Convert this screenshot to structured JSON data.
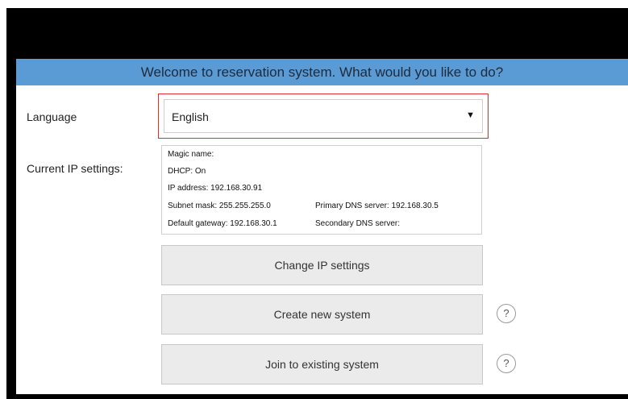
{
  "header": {
    "title": "Welcome to reservation system. What would you like to do?"
  },
  "language": {
    "label": "Language",
    "selected": "English",
    "arrow": "▼"
  },
  "ip": {
    "label": "Current IP settings:",
    "magic_name": "Magic name:",
    "dhcp": "DHCP: On",
    "ip_address": "IP address: 192.168.30.91",
    "subnet_mask": "Subnet mask: 255.255.255.0",
    "primary_dns": "Primary DNS server: 192.168.30.5",
    "default_gateway": "Default gateway: 192.168.30.1",
    "secondary_dns": "Secondary DNS server:"
  },
  "buttons": {
    "change_ip": "Change IP settings",
    "create_system": "Create new system",
    "join_system": "Join to existing system"
  },
  "help": {
    "symbol": "?"
  },
  "colors": {
    "header": "#5b9bd5",
    "focus_border": "#e0302a",
    "button_bg": "#ebebeb"
  }
}
